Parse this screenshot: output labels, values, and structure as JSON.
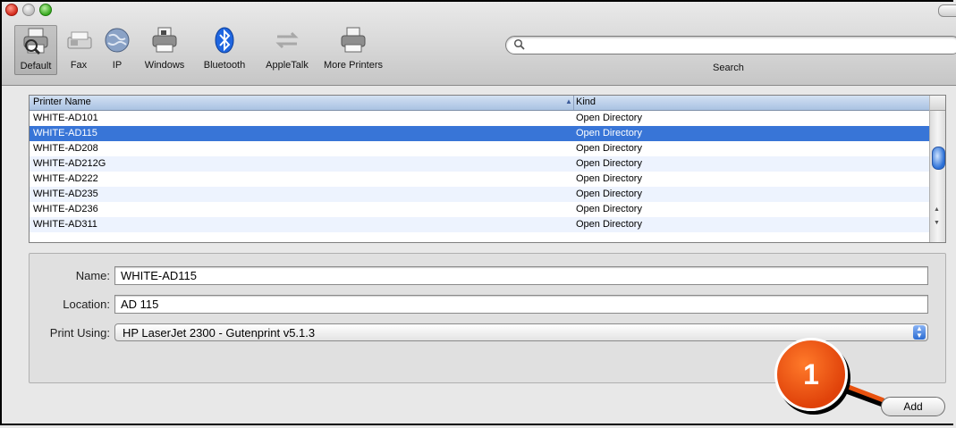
{
  "toolbar": {
    "items": [
      {
        "label": "Default",
        "icon": "printer-default-icon"
      },
      {
        "label": "Fax",
        "icon": "fax-icon"
      },
      {
        "label": "IP",
        "icon": "globe-icon"
      },
      {
        "label": "Windows",
        "icon": "windows-printer-icon"
      },
      {
        "label": "Bluetooth",
        "icon": "bluetooth-icon"
      },
      {
        "label": "AppleTalk",
        "icon": "appletalk-icon"
      },
      {
        "label": "More Printers",
        "icon": "more-printers-icon"
      }
    ],
    "search_label": "Search",
    "search_value": ""
  },
  "table": {
    "col_printer_name": "Printer Name",
    "col_kind": "Kind",
    "rows": [
      {
        "name": "WHITE-AD101",
        "kind": "Open Directory"
      },
      {
        "name": "WHITE-AD115",
        "kind": "Open Directory",
        "selected": true
      },
      {
        "name": "WHITE-AD208",
        "kind": "Open Directory"
      },
      {
        "name": "WHITE-AD212G",
        "kind": "Open Directory"
      },
      {
        "name": "WHITE-AD222",
        "kind": "Open Directory"
      },
      {
        "name": "WHITE-AD235",
        "kind": "Open Directory"
      },
      {
        "name": "WHITE-AD236",
        "kind": "Open Directory"
      },
      {
        "name": "WHITE-AD311",
        "kind": "Open Directory"
      }
    ]
  },
  "form": {
    "name_label": "Name:",
    "name_value": "WHITE-AD115",
    "location_label": "Location:",
    "location_value": "AD 115",
    "print_using_label": "Print Using:",
    "print_using_value": "HP LaserJet 2300 - Gutenprint v5.1.3"
  },
  "callout": {
    "number": "1"
  },
  "add_button_label": "Add",
  "colors": {
    "selection": "#3875d7",
    "callout": "#e8520f"
  }
}
